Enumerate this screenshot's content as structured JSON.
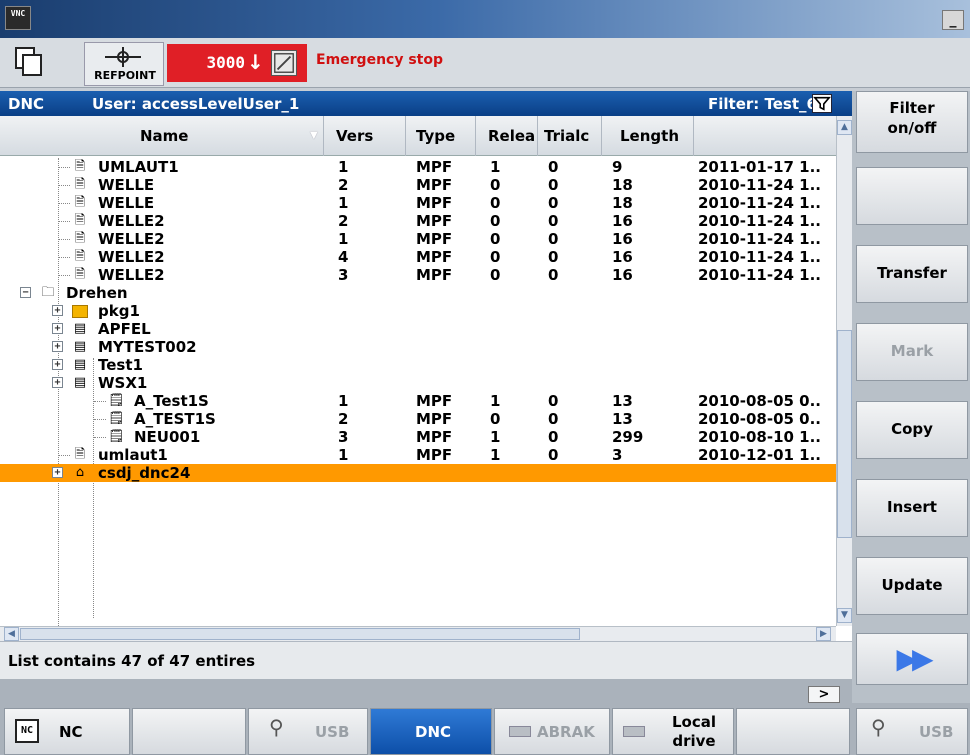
{
  "window": {
    "logo": "VNC",
    "minimize_glyph": "_"
  },
  "status": {
    "refpoint_label": "REFPOINT",
    "alarm_number": "3000",
    "alarm_text": "Emergency stop"
  },
  "header": {
    "title": "DNC",
    "user": "User: accessLevelUser_1",
    "filter": "Filter: Test_6"
  },
  "table": {
    "columns": [
      "Name",
      "Vers",
      "Type",
      "Relea",
      "Trialc",
      "Length",
      ""
    ],
    "rows": [
      {
        "name": "UMLAUT1",
        "icon": "doc",
        "vers": "1",
        "type": "MPF",
        "relea": "1",
        "trialc": "0",
        "length": "9",
        "date": "2011-01-17 1.."
      },
      {
        "name": "WELLE",
        "icon": "doc",
        "vers": "2",
        "type": "MPF",
        "relea": "0",
        "trialc": "0",
        "length": "18",
        "date": "2010-11-24 1.."
      },
      {
        "name": "WELLE",
        "icon": "doc",
        "vers": "1",
        "type": "MPF",
        "relea": "0",
        "trialc": "0",
        "length": "18",
        "date": "2010-11-24 1.."
      },
      {
        "name": "WELLE2",
        "icon": "doc",
        "vers": "2",
        "type": "MPF",
        "relea": "0",
        "trialc": "0",
        "length": "16",
        "date": "2010-11-24 1.."
      },
      {
        "name": "WELLE2",
        "icon": "doc",
        "vers": "1",
        "type": "MPF",
        "relea": "0",
        "trialc": "0",
        "length": "16",
        "date": "2010-11-24 1.."
      },
      {
        "name": "WELLE2",
        "icon": "doc",
        "vers": "4",
        "type": "MPF",
        "relea": "0",
        "trialc": "0",
        "length": "16",
        "date": "2010-11-24 1.."
      },
      {
        "name": "WELLE2",
        "icon": "doc",
        "vers": "3",
        "type": "MPF",
        "relea": "0",
        "trialc": "0",
        "length": "16",
        "date": "2010-11-24 1.."
      },
      {
        "name": "Drehen",
        "icon": "folder",
        "vers": "",
        "type": "",
        "relea": "",
        "trialc": "",
        "length": "",
        "date": ""
      },
      {
        "name": "pkg1",
        "icon": "pkg",
        "vers": "",
        "type": "",
        "relea": "",
        "trialc": "",
        "length": "",
        "date": ""
      },
      {
        "name": "APFEL",
        "icon": "ws",
        "vers": "",
        "type": "",
        "relea": "",
        "trialc": "",
        "length": "",
        "date": ""
      },
      {
        "name": "MYTEST002",
        "icon": "ws",
        "vers": "",
        "type": "",
        "relea": "",
        "trialc": "",
        "length": "",
        "date": ""
      },
      {
        "name": "Test1",
        "icon": "ws",
        "vers": "",
        "type": "",
        "relea": "",
        "trialc": "",
        "length": "",
        "date": ""
      },
      {
        "name": "WSX1",
        "icon": "ws",
        "vers": "",
        "type": "",
        "relea": "",
        "trialc": "",
        "length": "",
        "date": ""
      },
      {
        "name": "A_Test1S",
        "icon": "prog",
        "vers": "1",
        "type": "MPF",
        "relea": "1",
        "trialc": "0",
        "length": "13",
        "date": "2010-08-05 0.."
      },
      {
        "name": "A_TEST1S",
        "icon": "prog",
        "vers": "2",
        "type": "MPF",
        "relea": "0",
        "trialc": "0",
        "length": "13",
        "date": "2010-08-05 0.."
      },
      {
        "name": "NEU001",
        "icon": "prog",
        "vers": "3",
        "type": "MPF",
        "relea": "1",
        "trialc": "0",
        "length": "299",
        "date": "2010-08-10 1.."
      },
      {
        "name": "umlaut1",
        "icon": "doc",
        "vers": "1",
        "type": "MPF",
        "relea": "1",
        "trialc": "0",
        "length": "3",
        "date": "2010-12-01 1.."
      },
      {
        "name": "csdj_dnc24",
        "icon": "server",
        "vers": "",
        "type": "",
        "relea": "",
        "trialc": "",
        "length": "",
        "date": ""
      }
    ]
  },
  "info_line": "List contains 47 of 47 entires",
  "more_label": ">",
  "right_softkeys": [
    "Filter on/off",
    "",
    "Transfer",
    "Mark",
    "Copy",
    "Insert",
    "Update"
  ],
  "bottom_softkeys": {
    "nc": "NC",
    "usb": "USB",
    "dnc": "DNC",
    "abrak": "ABRAK",
    "local_drive": "Local drive",
    "usb2": "USB"
  },
  "colors": {
    "selected_row": "#ff9900",
    "alarm": "#e01f26",
    "header_blue": "#0a3f86"
  }
}
